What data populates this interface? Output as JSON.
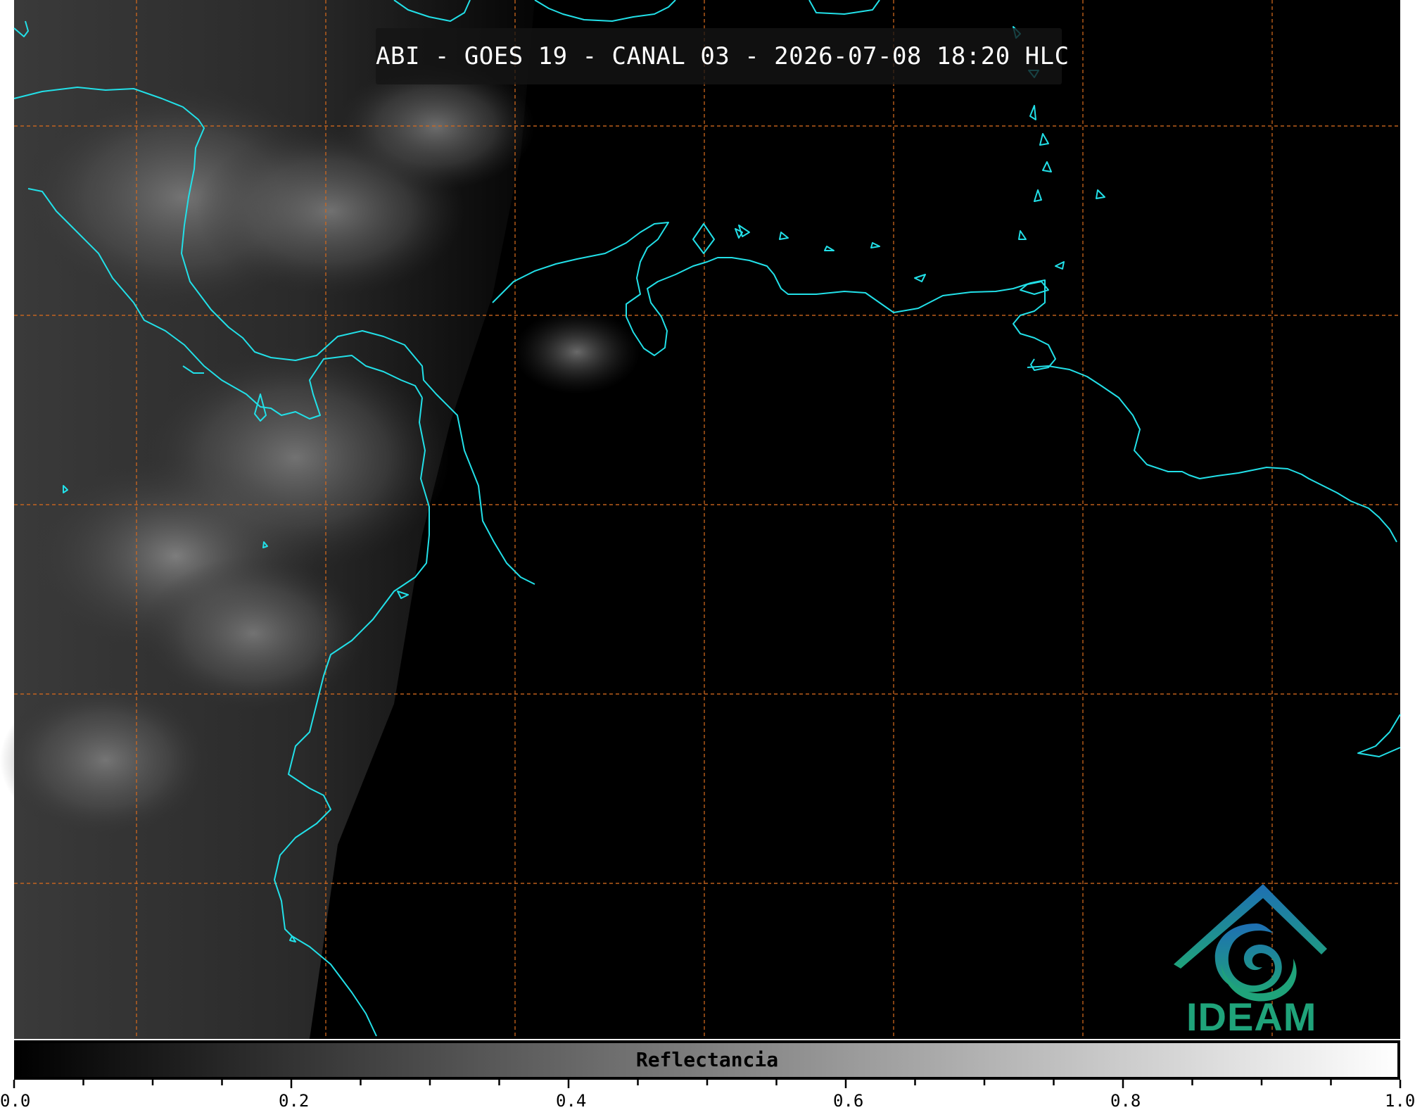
{
  "title": "ABI - GOES 19 - CANAL 03 - 2026-07-08 18:20 HLC",
  "colorbar": {
    "label": "Reflectancia",
    "ticks": [
      "0.0",
      "0.2",
      "0.4",
      "0.6",
      "0.8",
      "1.0"
    ],
    "range": [
      0.0,
      1.0
    ],
    "colormap": [
      "#000000",
      "#ffffff"
    ]
  },
  "logo": {
    "text": "IDEAM"
  },
  "colors": {
    "coastline": "#22e0e8",
    "gridline": "#d2691e",
    "background": "#000000",
    "logo_blue": "#1e6fb4",
    "logo_green": "#1fa37a"
  }
}
